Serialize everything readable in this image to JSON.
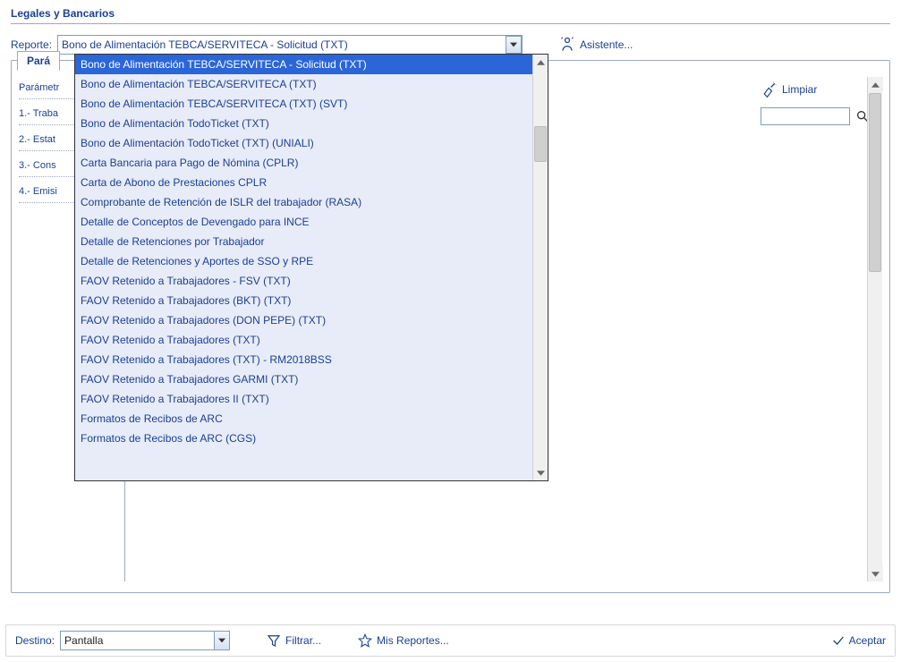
{
  "section": {
    "title": "Legales y Bancarios"
  },
  "report": {
    "label": "Reporte:",
    "selected": "Bono de Alimentación TEBCA/SERVITECA - Solicitud (TXT)",
    "options": [
      "Bono de Alimentación TEBCA/SERVITECA - Solicitud (TXT)",
      "Bono de Alimentación TEBCA/SERVITECA (TXT)",
      "Bono de Alimentación TEBCA/SERVITECA (TXT) (SVT)",
      "Bono de Alimentación TodoTicket (TXT)",
      "Bono de Alimentación TodoTicket (TXT) (UNIALI)",
      "Carta Bancaria para Pago de Nómina (CPLR)",
      "Carta de Abono de Prestaciones CPLR",
      "Comprobante de Retención de ISLR del trabajador (RASA)",
      "Detalle de Conceptos de Devengado para INCE",
      "Detalle de Retenciones por Trabajador",
      "Detalle de Retenciones y Aportes de SSO y RPE",
      "FAOV Retenido a Trabajadores - FSV (TXT)",
      "FAOV Retenido a Trabajadores (BKT) (TXT)",
      "FAOV Retenido a Trabajadores (DON PEPE) (TXT)",
      "FAOV Retenido a Trabajadores (TXT)",
      "FAOV Retenido a Trabajadores (TXT) - RM2018BSS",
      "FAOV Retenido a Trabajadores GARMI (TXT)",
      "FAOV Retenido a Trabajadores II (TXT)",
      "Formatos de Recibos de ARC",
      "Formatos de Recibos de ARC (CGS)"
    ]
  },
  "asistente": {
    "label": "Asistente..."
  },
  "tabs": {
    "parametros": "Pará"
  },
  "params": {
    "header": "Parámetr",
    "items": [
      "1.- Traba",
      "2.- Estat",
      "3.- Cons",
      "4.- Emisi"
    ]
  },
  "tools": {
    "limpiar": "Limpiar",
    "search_placeholder": ""
  },
  "bottom": {
    "destino_label": "Destino:",
    "destino_value": "Pantalla",
    "filtrar": "Filtrar...",
    "mis_reportes": "Mis Reportes...",
    "aceptar": "Aceptar"
  }
}
